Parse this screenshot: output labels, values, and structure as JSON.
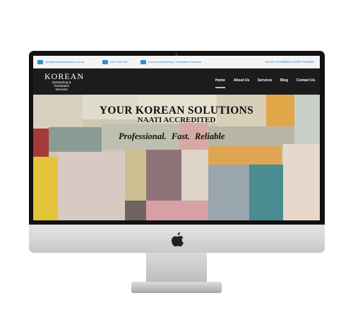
{
  "topbar": {
    "email": "info@koreantranslation.com.au",
    "phone": "0412 086 936",
    "facebook": "Korean Interpreting & Translation Services",
    "membership": "NAATI Accredited | AUSIT member"
  },
  "logo": {
    "title": "KOREAN",
    "subtitle": "Interpreting & Translation Services"
  },
  "nav": [
    "Home",
    "About Us",
    "Services",
    "Blog",
    "Contact Us"
  ],
  "hero": {
    "headline": "YOUR KOREAN SOLUTIONS",
    "subheadline": "NAATI ACCREDITED",
    "tagline": "Professional.  Fast.  Reliable"
  },
  "icons": [
    "email-icon",
    "phone-icon",
    "facebook-icon",
    "apple-logo-icon"
  ]
}
